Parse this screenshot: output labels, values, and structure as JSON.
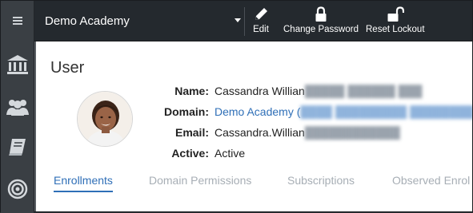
{
  "rail": {
    "icons": [
      "hamburger-menu-icon",
      "institution-icon",
      "users-icon",
      "book-icon",
      "target-icon"
    ]
  },
  "topbar": {
    "academy_name": "Demo Academy",
    "toolbar": [
      {
        "label": "Edit",
        "icon": "pencil-icon"
      },
      {
        "label": "Change Password",
        "icon": "lock-icon"
      },
      {
        "label": "Reset Lockout",
        "icon": "unlock-icon"
      }
    ]
  },
  "page": {
    "title": "User",
    "fields": [
      {
        "label": "Name:",
        "value": "Cassandra Willian"
      },
      {
        "label": "Domain:",
        "value": "Demo Academy ("
      },
      {
        "label": "Email:",
        "value": "Cassandra.Willian"
      },
      {
        "label": "Active:",
        "value": "Active"
      }
    ]
  },
  "tabs": [
    "Enrollments",
    "Domain Permissions",
    "Subscriptions",
    "Observed Enrol"
  ],
  "colors": {
    "accent": "#2f6fb7",
    "topbar": "#24292e",
    "rail": "#3a3f44",
    "tab_inactive": "#a7aeb5"
  }
}
